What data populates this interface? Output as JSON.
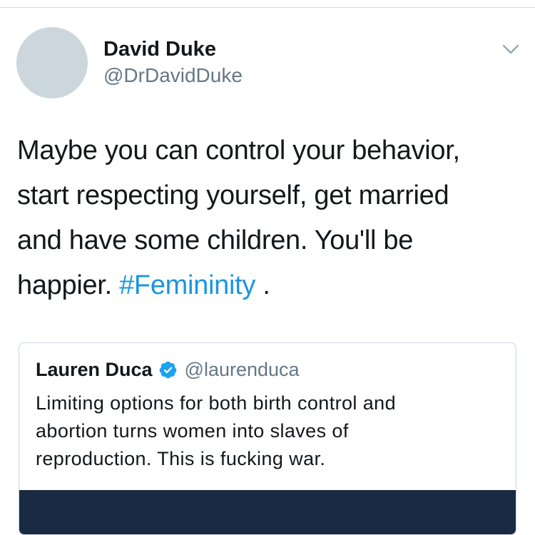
{
  "tweet": {
    "author": {
      "name": "David Duke",
      "handle": "@DrDavidDuke",
      "avatar_color": "#ccd6dd"
    },
    "menu_icon": "chevron-down-icon",
    "text_lines": [
      "Maybe you can control your behavior,",
      "start respecting yourself, get married",
      "and have some children. You'll be"
    ],
    "last_line_prefix": "happier. ",
    "hashtag": "#Femininity",
    "last_line_suffix": " ."
  },
  "quoted_tweet": {
    "author": {
      "name": "Lauren Duca",
      "handle": "@laurenduca",
      "verified": true,
      "verified_icon": "verified-badge-icon"
    },
    "text_lines": [
      "Limiting options for both birth control and",
      "abortion turns women into slaves of",
      "reproduction. This is fucking war."
    ],
    "media_color": "#1b2a43"
  },
  "colors": {
    "link": "#1b95e0",
    "secondary_text": "#657786",
    "primary_text": "#14171a",
    "verified": "#1da1f2"
  }
}
